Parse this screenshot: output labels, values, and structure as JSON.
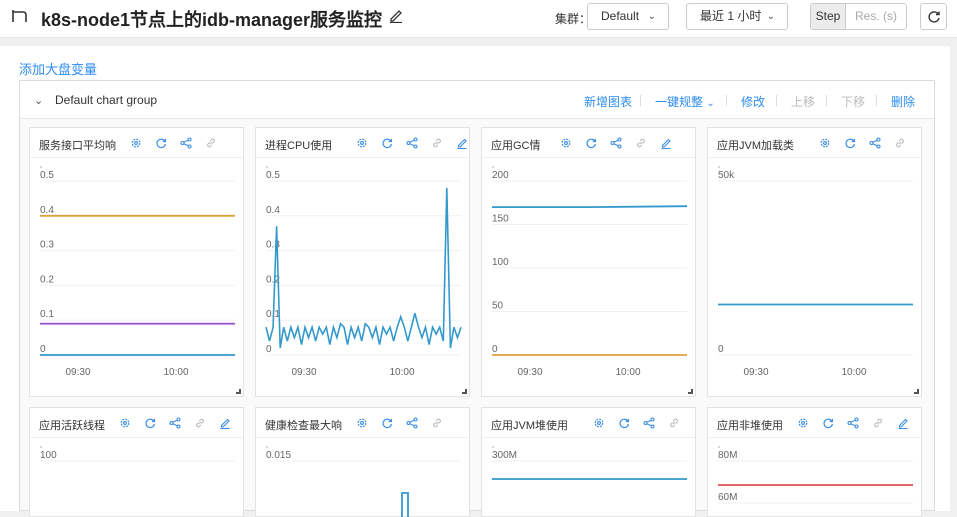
{
  "header": {
    "title": "k8s-node1节点上的idb-manager服务监控",
    "cluster_label": "集群：",
    "cluster_value": "Default",
    "time_range": "最近 1 小时",
    "step_label": "Step",
    "res_label": "Res. (s)"
  },
  "add_variable": "添加大盘变量",
  "group": {
    "title": "Default chart group",
    "actions": {
      "new_chart": "新增图表",
      "one_click": "一键规整",
      "modify": "修改",
      "move_up": "上移",
      "move_down": "下移",
      "delete": "删除"
    }
  },
  "colors": {
    "accent": "#2d8cf0",
    "blue": "#3399cc",
    "orange": "#e0a03c",
    "purple": "#9b59d0",
    "red": "#d9534f"
  },
  "panels": [
    {
      "title": "服务接口平均响",
      "icons": [
        "settings",
        "refresh",
        "share",
        "link"
      ],
      "yticks": [
        "0.5",
        "0.4",
        "0.3",
        "0.2",
        "0.1",
        "0"
      ],
      "xticks": [
        "09:30",
        "10:00"
      ]
    },
    {
      "title": "进程CPU使用",
      "icons": [
        "settings",
        "refresh",
        "share",
        "link",
        "edit"
      ],
      "yticks": [
        "0.5",
        "0.4",
        "0.3",
        "0.2",
        "0.1",
        "0"
      ],
      "xticks": [
        "09:30",
        "10:00"
      ]
    },
    {
      "title": "应用GC情",
      "icons": [
        "settings",
        "refresh",
        "share",
        "link",
        "edit"
      ],
      "yticks": [
        "200",
        "150",
        "100",
        "50",
        "0"
      ],
      "xticks": [
        "09:30",
        "10:00"
      ]
    },
    {
      "title": "应用JVM加载类",
      "icons": [
        "settings",
        "refresh",
        "share",
        "link"
      ],
      "yticks": [
        "50k",
        "0"
      ],
      "xticks": [
        "09:30",
        "10:00"
      ]
    },
    {
      "title": "应用活跃线程",
      "icons": [
        "settings",
        "refresh",
        "share",
        "link",
        "edit"
      ],
      "yticks": [
        "100"
      ],
      "xticks": []
    },
    {
      "title": "健康检查最大响",
      "icons": [
        "settings",
        "refresh",
        "share",
        "link"
      ],
      "yticks": [
        "0.015"
      ],
      "xticks": []
    },
    {
      "title": "应用JVM堆使用",
      "icons": [
        "settings",
        "refresh",
        "share",
        "link"
      ],
      "yticks": [
        "300M"
      ],
      "xticks": []
    },
    {
      "title": "应用非堆使用",
      "icons": [
        "settings",
        "refresh",
        "share",
        "link",
        "edit"
      ],
      "yticks": [
        "80M",
        "60M"
      ],
      "xticks": []
    }
  ],
  "chart_data": [
    {
      "type": "line",
      "title": "服务接口平均响",
      "ylim": [
        0,
        0.5
      ],
      "x": [
        "09:30",
        "10:00"
      ],
      "series": [
        {
          "values": [
            0.4,
            0.4
          ],
          "color": "#e0a03c"
        },
        {
          "values": [
            0.09,
            0.09
          ],
          "color": "#9b59d0"
        },
        {
          "values": [
            0,
            0
          ],
          "color": "#3399cc"
        }
      ]
    },
    {
      "type": "line",
      "title": "进程CPU使用",
      "ylim": [
        0,
        0.5
      ],
      "x": [
        "09:30",
        "10:00"
      ],
      "series": [
        {
          "values": [
            0.08,
            0.04,
            0.08,
            0.37,
            0.02,
            0.08,
            0.04,
            0.08,
            0.05,
            0.08,
            0.03,
            0.08,
            0.05,
            0.08,
            0.04,
            0.08,
            0.06,
            0.08,
            0.03,
            0.08,
            0.05,
            0.09,
            0.08,
            0.03,
            0.08,
            0.05,
            0.08,
            0.04,
            0.09,
            0.08,
            0.05,
            0.08,
            0.03,
            0.08,
            0.06,
            0.08,
            0.04,
            0.08,
            0.11,
            0.08,
            0.04,
            0.08,
            0.12,
            0.08,
            0.05,
            0.08,
            0.03,
            0.08,
            0.06,
            0.08,
            0.04,
            0.48,
            0.02,
            0.08,
            0.05,
            0.08
          ],
          "color": "#3399cc"
        }
      ]
    },
    {
      "type": "line",
      "title": "应用GC情",
      "ylim": [
        0,
        200
      ],
      "x": [
        "09:30",
        "10:00"
      ],
      "series": [
        {
          "values": [
            170,
            170,
            171
          ],
          "color": "#3399cc"
        },
        {
          "values": [
            0,
            0,
            0
          ],
          "color": "#e0a03c"
        }
      ]
    },
    {
      "type": "line",
      "title": "应用JVM加载类",
      "ylim": [
        0,
        50000
      ],
      "x": [
        "09:30",
        "10:00"
      ],
      "series": [
        {
          "values": [
            14500,
            14500
          ],
          "color": "#3399cc"
        }
      ]
    },
    {
      "type": "line",
      "title": "应用活跃线程",
      "series": []
    },
    {
      "type": "line",
      "title": "健康检查最大响",
      "series": []
    },
    {
      "type": "line",
      "title": "应用JVM堆使用",
      "series": []
    },
    {
      "type": "line",
      "title": "应用非堆使用",
      "series": []
    }
  ]
}
